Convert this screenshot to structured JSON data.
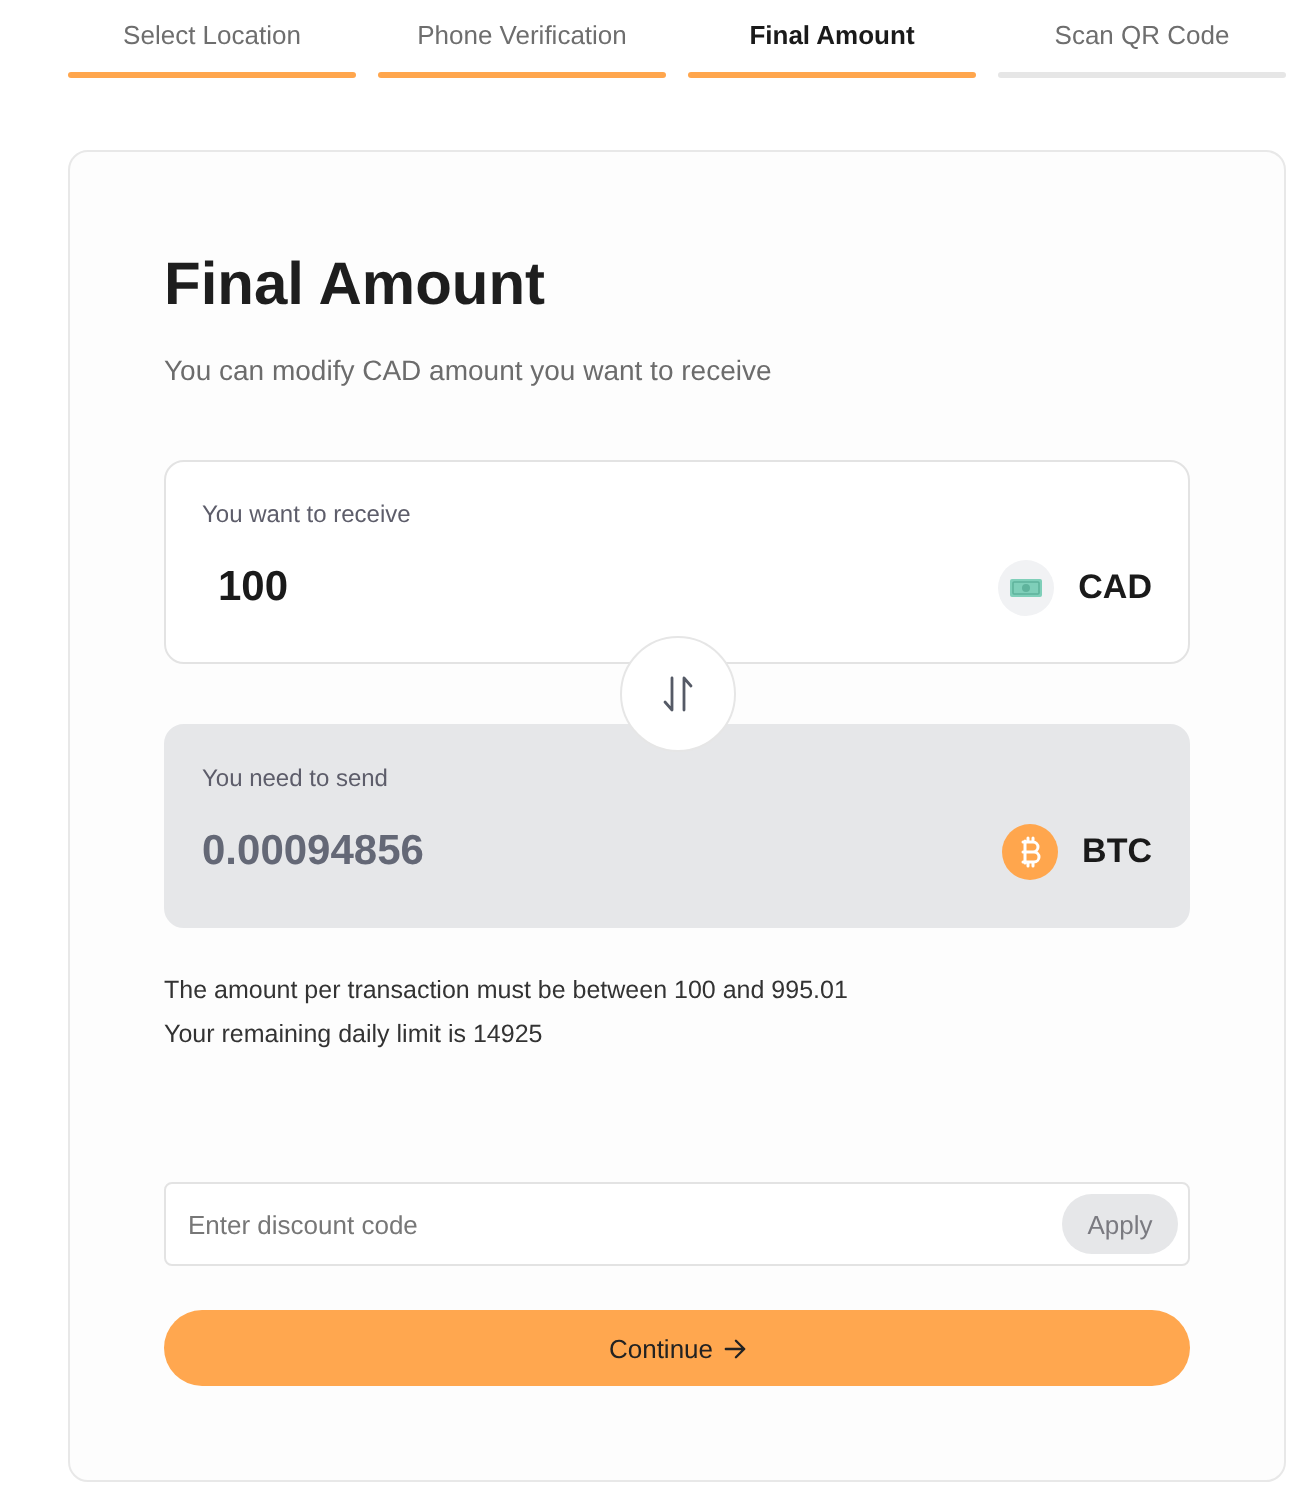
{
  "steps": [
    {
      "label": "Select Location",
      "selected": false,
      "reached": true
    },
    {
      "label": "Phone Verification",
      "selected": false,
      "reached": true
    },
    {
      "label": "Final Amount",
      "selected": true,
      "reached": true
    },
    {
      "label": "Scan QR Code",
      "selected": false,
      "reached": false
    }
  ],
  "heading": {
    "title": "Final Amount",
    "subtitle": "You can modify CAD amount you want to receive"
  },
  "amounts": [
    {
      "kind": "receive",
      "label": "You want to receive",
      "value": "100",
      "currency": "CAD"
    },
    {
      "kind": "send",
      "label": "You need to send",
      "value": "0.00094856",
      "currency": "BTC"
    }
  ],
  "notes": [
    "The amount per transaction must be between 100 and 995.01",
    "Your remaining daily limit is 14925"
  ],
  "discount": {
    "placeholder": "Enter discount code",
    "button": "Apply"
  },
  "continue_button": {
    "label": "Continue"
  }
}
